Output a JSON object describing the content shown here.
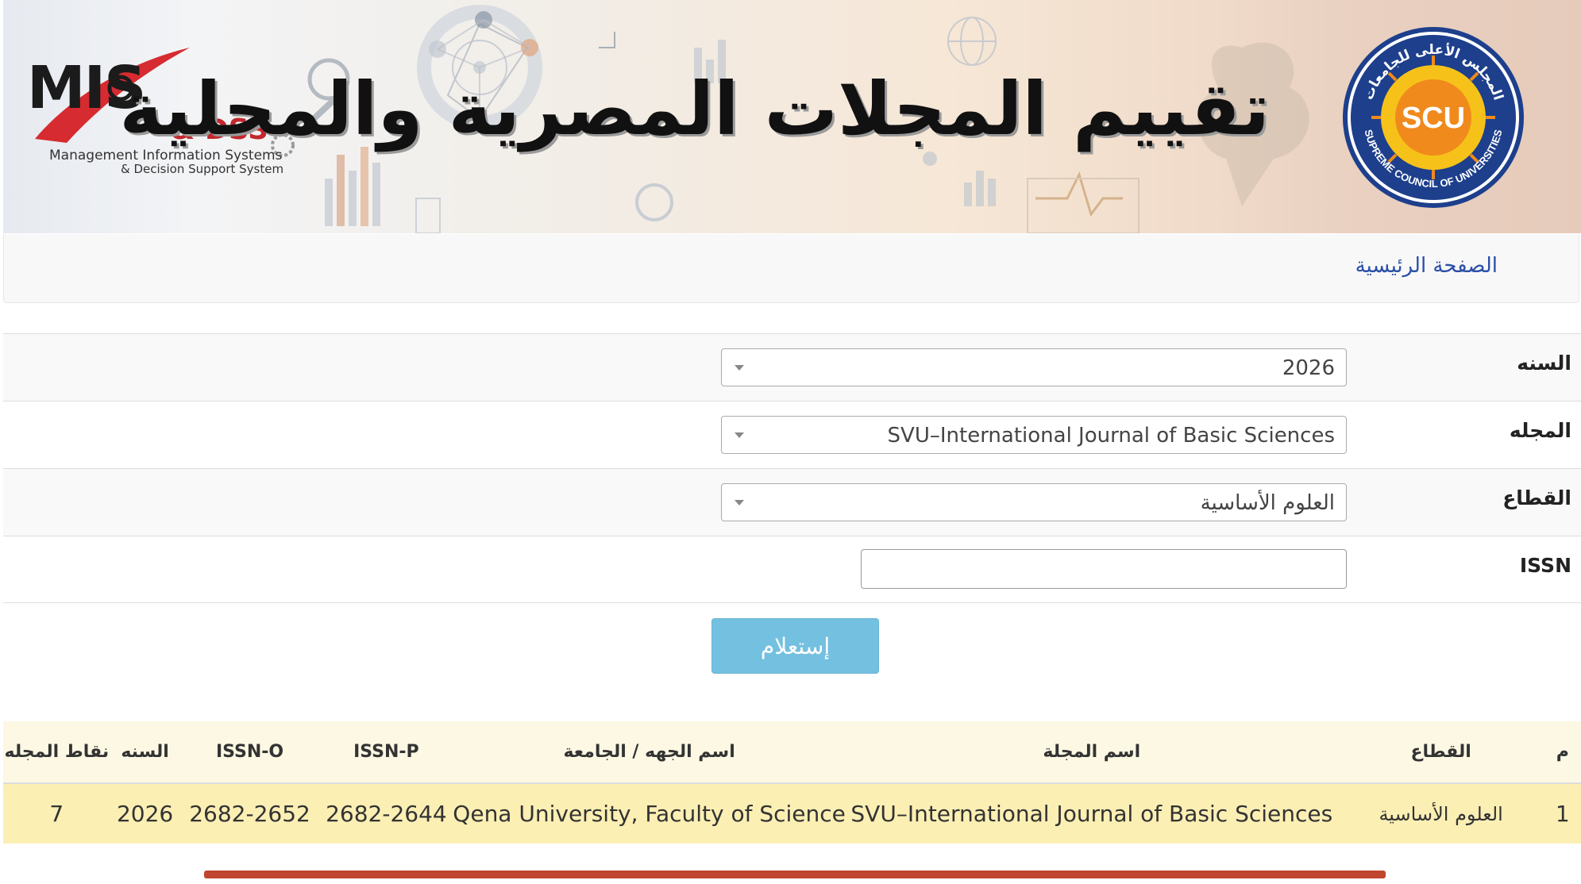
{
  "banner": {
    "title": "تقييم المجلات المصرية والمحلية",
    "left_logo": {
      "main": "MIS",
      "dss": "& DSS",
      "subtitle_1": "Management Information Systems",
      "subtitle_2": "& Decision Support System"
    },
    "right_logo": {
      "center": "SCU",
      "ring_top": "المجلس الأعلى للجامعات",
      "ring_bottom": "SUPREME COUNCIL OF UNIVERSITIES"
    }
  },
  "breadcrumb": {
    "home": "الصفحة الرئيسية"
  },
  "form": {
    "year": {
      "label": "السنه",
      "value": "2026"
    },
    "journal": {
      "label": "المجله",
      "value": "SVU–International Journal of Basic Sciences"
    },
    "sector": {
      "label": "القطاع",
      "value": "العلوم الأساسية"
    },
    "issn": {
      "label": "ISSN",
      "value": "",
      "placeholder": ""
    },
    "submit_label": "إستعلام"
  },
  "results": {
    "headers": {
      "index": "م",
      "sector": "القطاع",
      "journal_name": "اسم المجلة",
      "institution": "اسم الجهه / الجامعة",
      "issn_p": "ISSN-P",
      "issn_o": "ISSN-O",
      "year": "السنه",
      "points": "نقاط المجله"
    },
    "rows": [
      {
        "index": "1",
        "sector": "العلوم الأساسية",
        "journal_name": "SVU–International Journal of Basic Sciences",
        "institution": "Qena University, Faculty of Science",
        "issn_p": "2682-2644",
        "issn_o": "2682-2652",
        "year": "2026",
        "points": "7"
      }
    ]
  },
  "colors": {
    "accent_link": "#2a4fa8",
    "button": "#73c0e0",
    "row_highlight": "#fcefb4",
    "header_bg": "#fcf8e3",
    "footer_line": "#c0462f"
  }
}
